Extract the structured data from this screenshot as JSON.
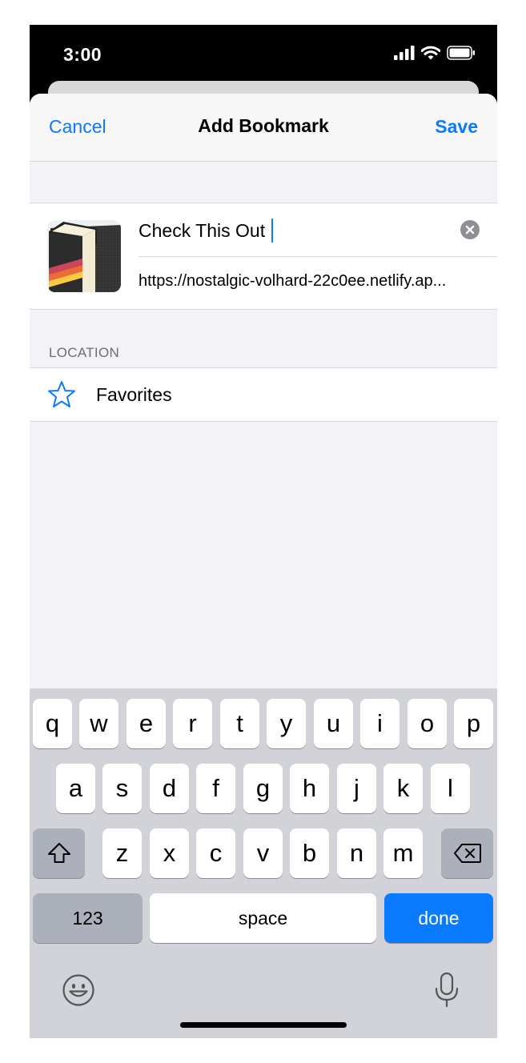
{
  "status_bar": {
    "time": "3:00",
    "icons": [
      "signal-icon",
      "wifi-icon",
      "battery-icon"
    ]
  },
  "nav": {
    "cancel_label": "Cancel",
    "title": "Add Bookmark",
    "save_label": "Save"
  },
  "bookmark": {
    "title_value": "Check This Out",
    "url": "https://nostalgic-volhard-22c0ee.netlify.ap..."
  },
  "location": {
    "section_label": "LOCATION",
    "folder_label": "Favorites"
  },
  "keyboard": {
    "row1": [
      "q",
      "w",
      "e",
      "r",
      "t",
      "y",
      "u",
      "i",
      "o",
      "p"
    ],
    "row2": [
      "a",
      "s",
      "d",
      "f",
      "g",
      "h",
      "j",
      "k",
      "l"
    ],
    "row3": [
      "z",
      "x",
      "c",
      "v",
      "b",
      "n",
      "m"
    ],
    "numbers_label": "123",
    "space_label": "space",
    "done_label": "done"
  },
  "colors": {
    "accent": "#0a7aff",
    "sheet_background": "#f2f2f7",
    "keyboard_background": "#d1d3d9"
  }
}
